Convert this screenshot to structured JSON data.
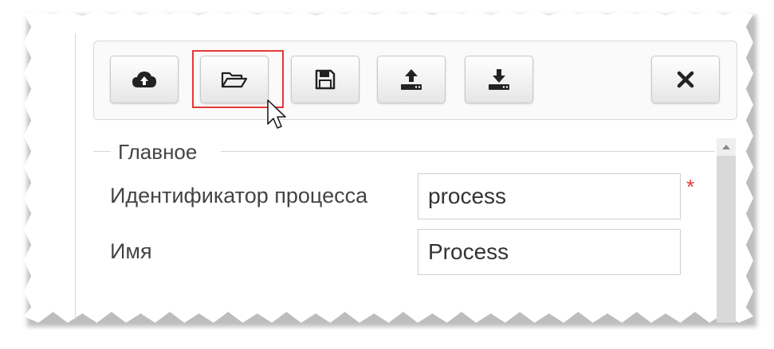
{
  "toolbar": {
    "buttons": [
      {
        "icon": "cloud-upload-icon"
      },
      {
        "icon": "folder-open-icon"
      },
      {
        "icon": "floppy-disk-icon"
      },
      {
        "icon": "upload-icon"
      },
      {
        "icon": "download-icon"
      },
      {
        "icon": "close-icon"
      }
    ],
    "highlight_color": "#e53935"
  },
  "section": {
    "title": "Главное"
  },
  "form": {
    "process_id_label": "Идентификатор процесса",
    "process_id_value": "process",
    "required_mark": "*",
    "name_label": "Имя",
    "name_value": "Process"
  },
  "colors": {
    "text": "#444444",
    "required": "#e53935",
    "border": "#cfcfcf"
  }
}
